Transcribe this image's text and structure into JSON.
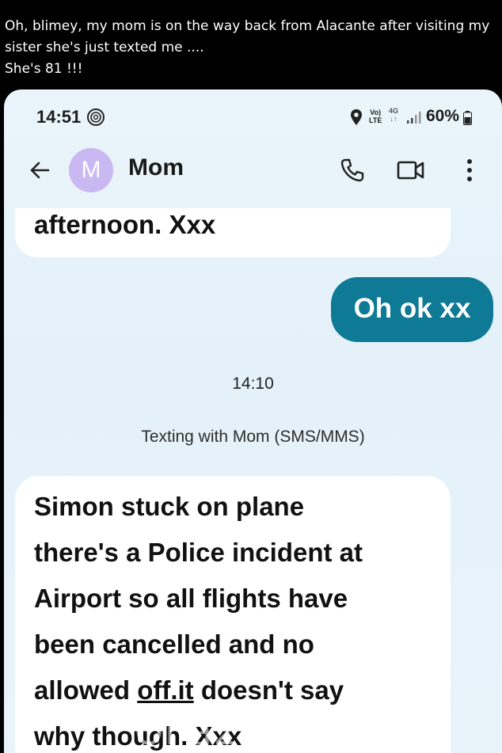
{
  "post": {
    "caption_lines": [
      "Oh, blimey, my mom is on the way back from Alacante after visiting my",
      "sister she's just texted me ....",
      "She's 81 !!!"
    ]
  },
  "status_bar": {
    "time": "14:51",
    "volte_top": "Vo)",
    "volte_bottom": "LTE",
    "network_top": "4G",
    "network_bottom": "↓↑",
    "battery": "60%"
  },
  "header": {
    "avatar_letter": "M",
    "contact_name": "Mom"
  },
  "messages": {
    "top_incoming": "afternoon. Xxx",
    "outgoing": "Oh ok xx",
    "timestamp": "14:10",
    "thread_info": "Texting with Mom (SMS/MMS)",
    "incoming_lines": [
      "Simon stuck on plane",
      "there's a Police  incident at",
      "Airport so all flights  have",
      "been cancelled and no"
    ],
    "line5_before": "allowed ",
    "line5_underlined": "off.it",
    "line5_after": " doesn't say",
    "line6": "why though. Xxx"
  },
  "watermark": "Oi      a2au",
  "colors": {
    "outgoing_bubble": "#0e7a96",
    "avatar": "#c9b8f2",
    "background": "#e6f2fa"
  }
}
